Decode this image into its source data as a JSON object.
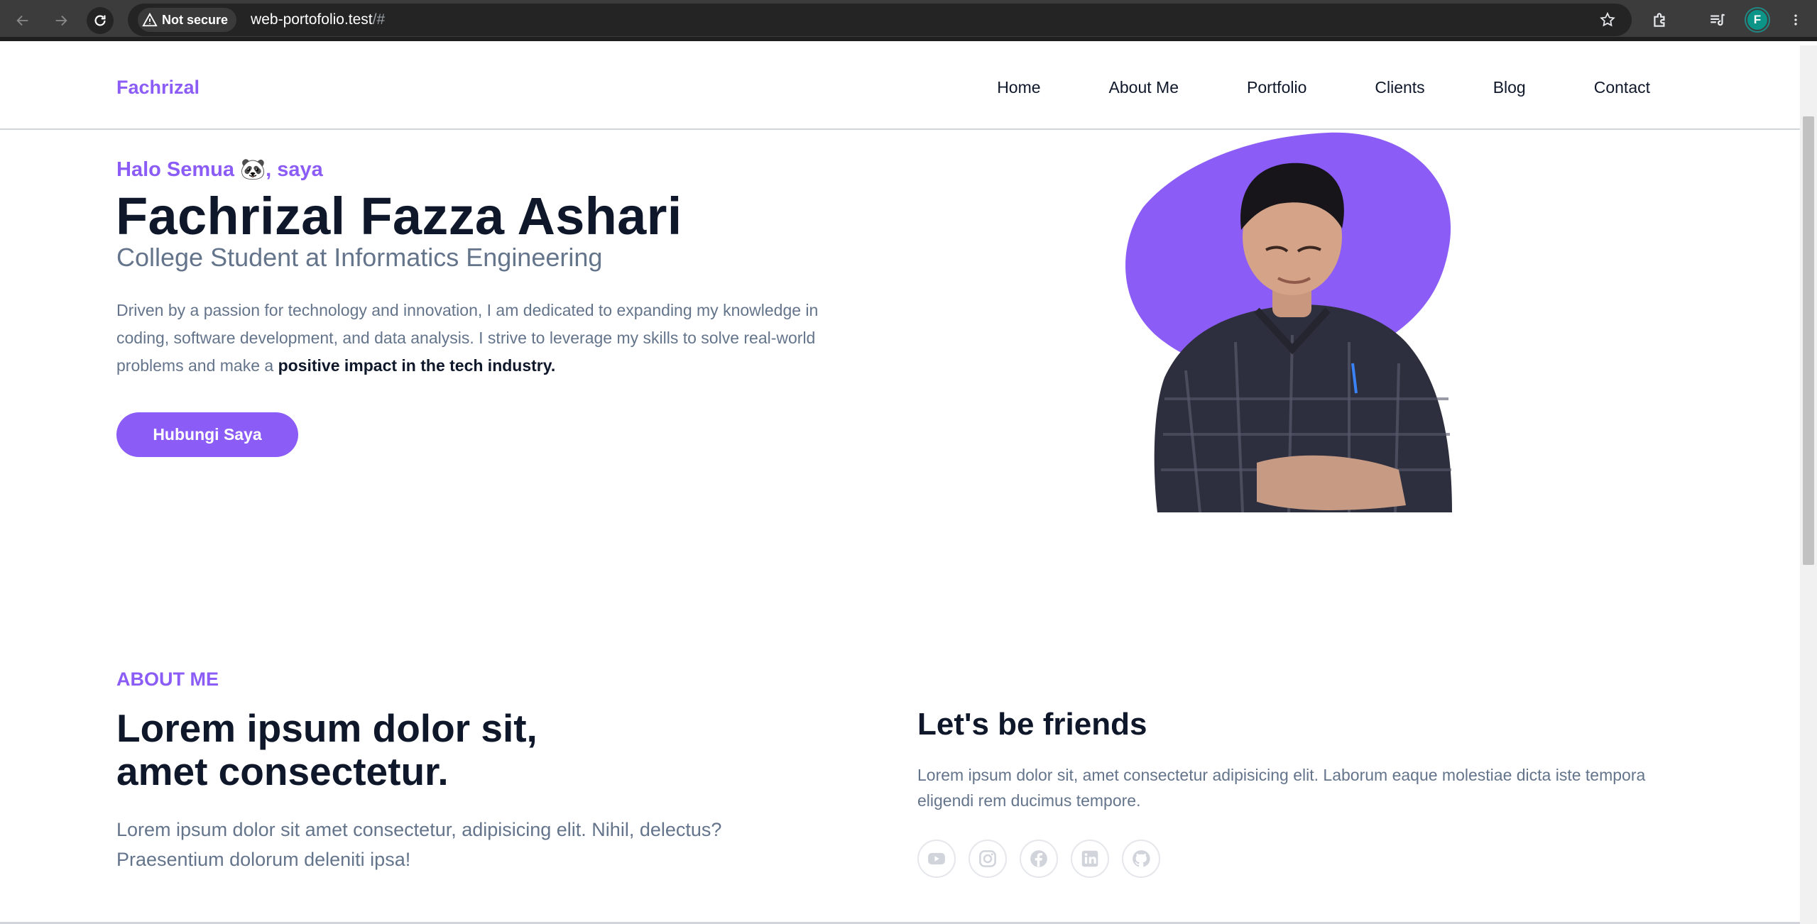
{
  "browser": {
    "security_label": "Not secure",
    "url_host": "web-portofolio.test",
    "url_path": "/#",
    "profile_initial": "F",
    "icons": [
      "back-arrow-icon",
      "forward-arrow-icon",
      "reload-icon",
      "warning-icon",
      "star-icon",
      "extensions-icon",
      "media-icon",
      "kebab-menu-icon"
    ]
  },
  "header": {
    "brand": "Fachrizal",
    "nav": [
      "Home",
      "About Me",
      "Portfolio",
      "Clients",
      "Blog",
      "Contact"
    ]
  },
  "hero": {
    "greeting": "Halo Semua 🐼, saya",
    "name": "Fachrizal Fazza Ashari",
    "role": "College Student at Informatics Engineering",
    "description": "Driven by a passion for technology and innovation, I am dedicated to expanding my knowledge in coding, software development, and data analysis. I strive to leverage my skills to solve real-world problems and make a",
    "description_bold": "positive impact in the tech industry.",
    "cta": "Hubungi Saya"
  },
  "about": {
    "eyebrow": "ABOUT ME",
    "heading_line1": "Lorem ipsum dolor sit,",
    "heading_line2": "amet consectetur.",
    "text": "Lorem ipsum dolor sit amet consectetur, adipisicing elit. Nihil, delectus? Praesentium dolorum deleniti ipsa!",
    "friends_heading": "Let's be friends",
    "friends_text": "Lorem ipsum dolor sit, amet consectetur adipisicing elit. Laborum eaque molestiae dicta iste tempora eligendi rem ducimus tempore.",
    "socials": [
      "youtube-icon",
      "instagram-icon",
      "facebook-icon",
      "linkedin-icon",
      "github-icon"
    ]
  },
  "colors": {
    "accent": "#8b5cf6",
    "heading": "#0f172a",
    "muted": "#64748b",
    "chrome_bg": "#3c3c3c",
    "social_border": "#e5e7eb"
  }
}
